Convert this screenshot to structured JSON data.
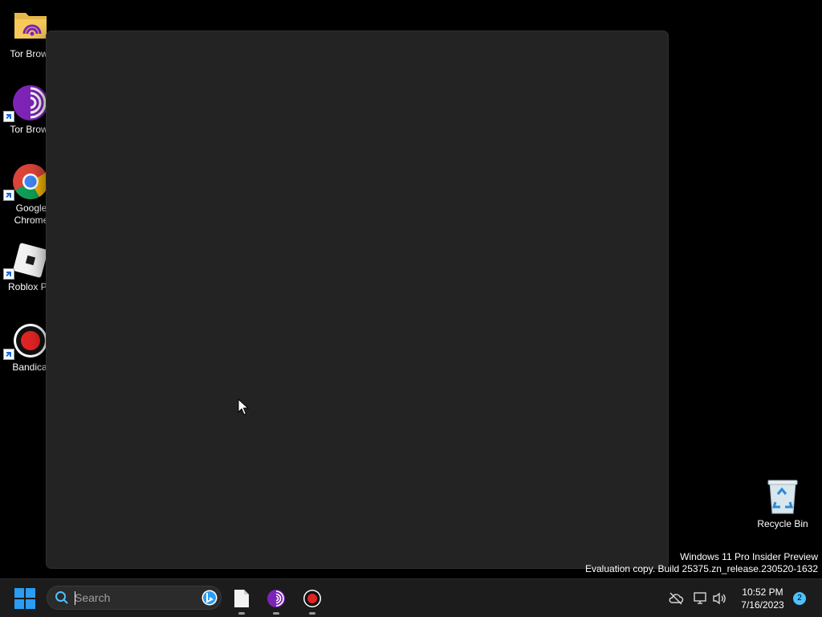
{
  "desktop": {
    "icons": [
      {
        "label": "Tor Brows",
        "icon": "folder-icon"
      },
      {
        "label": "Tor Brows",
        "icon": "tor-browser-icon"
      },
      {
        "label": "Google Chrome",
        "icon": "chrome-icon"
      },
      {
        "label": "Roblox Pla",
        "icon": "roblox-icon"
      },
      {
        "label": "Bandicar",
        "icon": "bandicam-icon"
      }
    ],
    "recycle_bin": {
      "label": "Recycle Bin",
      "icon": "recycle-bin-icon"
    }
  },
  "watermark": {
    "line1": "Windows 11 Pro Insider Preview",
    "line2": "Evaluation copy. Build 25375.zn_release.230520-1632"
  },
  "taskbar": {
    "search": {
      "placeholder": "Search"
    },
    "apps": [
      {
        "name": "file",
        "icon": "file-icon"
      },
      {
        "name": "tor-browser",
        "icon": "tor-browser-icon"
      },
      {
        "name": "bandicam",
        "icon": "bandicam-icon"
      }
    ],
    "clock": {
      "time": "10:52 PM",
      "date": "7/16/2023"
    },
    "notifications": {
      "count": "2"
    }
  },
  "colors": {
    "window_bg": "#232323",
    "taskbar_bg": "#1c1c1c",
    "accent": "#4cc2ff",
    "tor_purple": "#7d24b8",
    "bandicam_red": "#e02424"
  }
}
